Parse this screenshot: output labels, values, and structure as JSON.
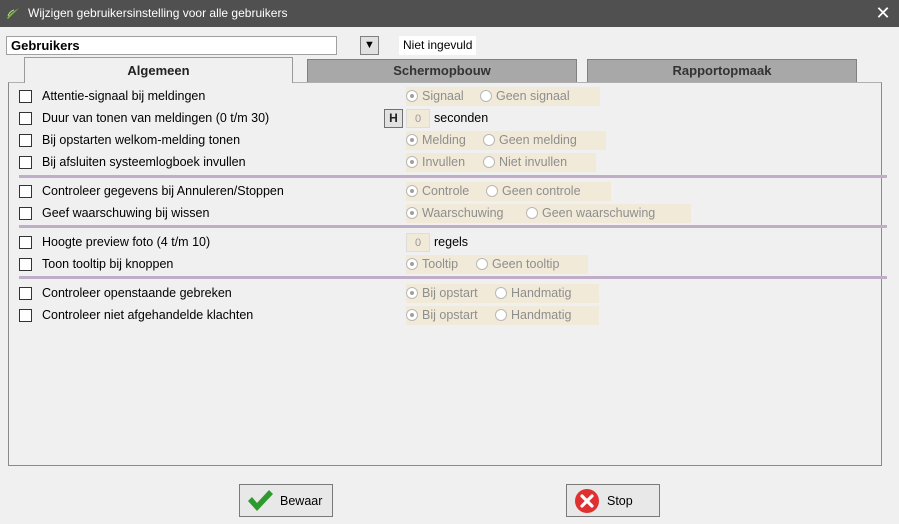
{
  "window": {
    "title": "Wijzigen gebruikersinstelling voor alle gebruikers",
    "close_glyph": "✕"
  },
  "toprow": {
    "selected": "Gebruikers",
    "dropdown_glyph": "▼",
    "status": "Niet ingevuld"
  },
  "tabs": [
    {
      "label": "Algemeen",
      "active": true
    },
    {
      "label": "Schermopbouw",
      "active": false
    },
    {
      "label": "Rapportopmaak",
      "active": false
    }
  ],
  "settings": [
    {
      "label": "Attentie-signaal bij meldingen",
      "options": [
        "Signaal",
        "Geen signaal"
      ],
      "selected": 0
    },
    {
      "label": "Duur van tonen van meldingen (0 t/m 30)",
      "h_button": "H",
      "value": "0",
      "unit": "seconden"
    },
    {
      "label": "Bij opstarten welkom-melding tonen",
      "options": [
        "Melding",
        "Geen melding"
      ],
      "selected": 0
    },
    {
      "label": "Bij afsluiten systeemlogboek invullen",
      "options": [
        "Invullen",
        "Niet invullen"
      ],
      "selected": 0
    },
    {
      "label": "Controleer gegevens bij Annuleren/Stoppen",
      "options": [
        "Controle",
        "Geen controle"
      ],
      "selected": 0
    },
    {
      "label": "Geef waarschuwing bij wissen",
      "options": [
        "Waarschuwing",
        "Geen waarschuwing"
      ],
      "selected": 0
    },
    {
      "label": "Hoogte preview foto (4 t/m 10)",
      "value": "0",
      "unit": "regels"
    },
    {
      "label": "Toon tooltip bij knoppen",
      "options": [
        "Tooltip",
        "Geen tooltip"
      ],
      "selected": 0
    },
    {
      "label": "Controleer openstaande gebreken",
      "options": [
        "Bij opstart",
        "Handmatig"
      ],
      "selected": 0
    },
    {
      "label": "Controleer niet afgehandelde klachten",
      "options": [
        "Bij opstart",
        "Handmatig"
      ],
      "selected": 0
    }
  ],
  "footer": {
    "save_label": "Bewaar",
    "stop_label": "Stop"
  },
  "colors": {
    "titlebar": "#505050",
    "disabled_field": "#f1ead9",
    "separator": "#c0aec9",
    "save_check": "#2e9a2e",
    "stop_icon": "#e03030"
  },
  "icons": {
    "app": "leaf-icon",
    "close": "close-icon",
    "dropdown": "triangle-down-icon",
    "save": "checkmark-icon",
    "stop": "stop-x-icon"
  }
}
